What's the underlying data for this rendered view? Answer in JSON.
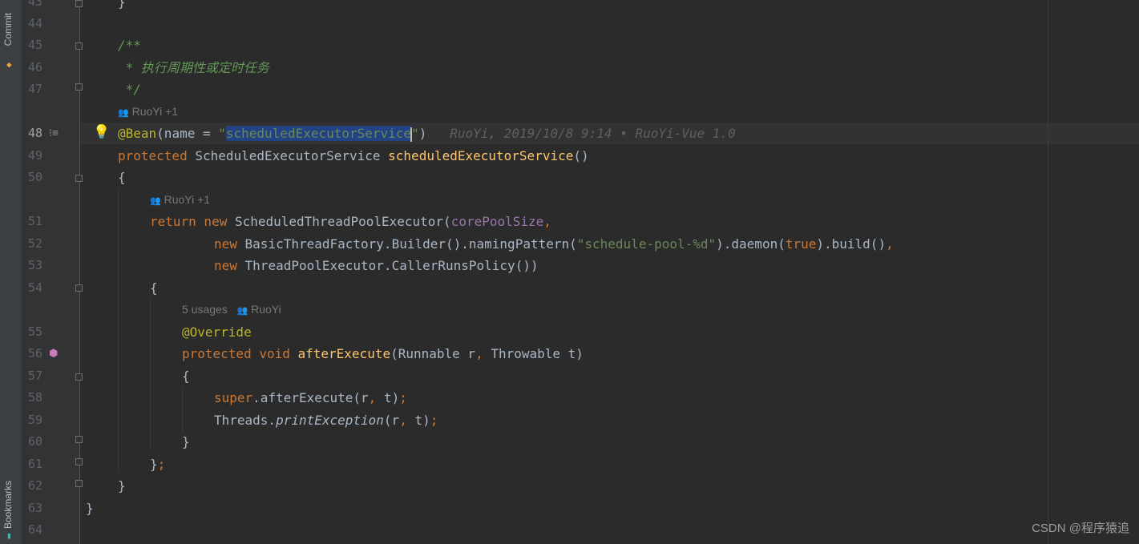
{
  "sidebar": {
    "commit_label": "Commit",
    "bookmarks_label": "Bookmarks"
  },
  "editor": {
    "line_numbers": [
      "43",
      "44",
      "45",
      "46",
      "47",
      "48",
      "49",
      "50",
      "51",
      "52",
      "53",
      "54",
      "55",
      "56",
      "57",
      "58",
      "59",
      "60",
      "61",
      "62",
      "63",
      "64"
    ],
    "current_line": "48",
    "inlay_hints": {
      "author_bean": "RuoYi +1",
      "author_return": "RuoYi +1",
      "usages": "5 usages",
      "author_override": "RuoYi"
    },
    "blame_annotation": "RuoYi, 2019/10/8 9:14 • RuoYi-Vue 1.0",
    "lines": {
      "l43": "}",
      "l45": "/**",
      "l46": " * 执行周期性或定时任务",
      "l47": " */",
      "l48_ann": "@Bean",
      "l48_open": "(name = ",
      "l48_q1": "\"",
      "l48_sel": "scheduledExecutorService",
      "l48_q2": "\"",
      "l48_close": ")",
      "l49_kw": "protected",
      "l49_type": " ScheduledExecutorService ",
      "l49_fn": "scheduledExecutorService",
      "l49_paren": "()",
      "l50": "{",
      "l51_kw1": "return",
      "l51_kw2": " new",
      "l51_type": " ScheduledThreadPoolExecutor(",
      "l51_param": "corePoolSize",
      "l51_comma": ",",
      "l52_kw": "new",
      "l52_a": " BasicThreadFactory.Builder().namingPattern(",
      "l52_str": "\"schedule-pool-%d\"",
      "l52_b": ").daemon(",
      "l52_true": "true",
      "l52_c": ").build()",
      "l52_comma": ",",
      "l53_kw": "new",
      "l53_a": " ThreadPoolExecutor.CallerRunsPolicy())",
      "l54": "{",
      "l55": "@Override",
      "l56_kw": "protected void",
      "l56_fn": " afterExecute",
      "l56_a": "(Runnable r",
      "l56_comma": ",",
      "l56_b": " Throwable t)",
      "l57": "{",
      "l58_kw": "super",
      "l58_a": ".afterExecute(r",
      "l58_comma": ",",
      "l58_b": " t)",
      "l58_semi": ";",
      "l59_a": "Threads.",
      "l59_ital": "printException",
      "l59_b": "(r",
      "l59_comma": ",",
      "l59_c": " t)",
      "l59_semi": ";",
      "l60": "}",
      "l61_a": "}",
      "l61_semi": ";",
      "l62": "}",
      "l63": "}"
    }
  },
  "watermark": "CSDN @程序猿追",
  "icons": {
    "bulb": "lightbulb-icon",
    "implement": "implementation-marker-icon",
    "override": "override-marker-icon"
  }
}
